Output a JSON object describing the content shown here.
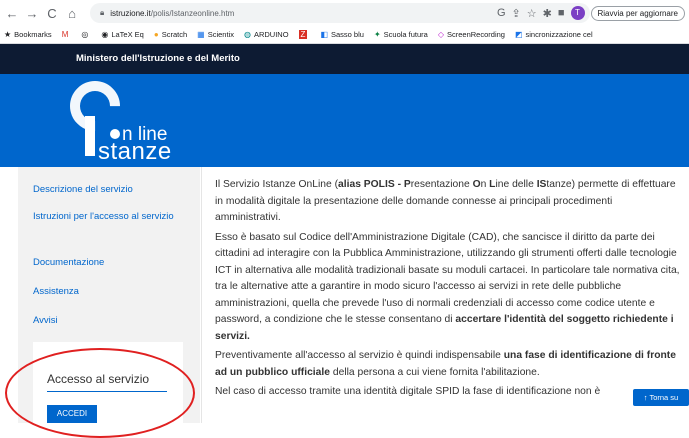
{
  "browser": {
    "back": "←",
    "forward": "→",
    "reload": "C",
    "home": "⌂",
    "url_domain": "istruzione.it",
    "url_path": "/polis/Istanzeonline.htm",
    "reload_pill": "Riavvia per aggiornare"
  },
  "bookmarks": [
    {
      "icon": "★",
      "label": "Bookmarks"
    },
    {
      "icon": "M",
      "label": ""
    },
    {
      "icon": "◎",
      "label": ""
    },
    {
      "icon": "◉",
      "label": "LaTeX Eq"
    },
    {
      "icon": "●",
      "label": "Scratch"
    },
    {
      "icon": "▦",
      "label": "Scientix"
    },
    {
      "icon": "◍",
      "label": "ARDUINO"
    },
    {
      "icon": "Z",
      "label": ""
    },
    {
      "icon": "◧",
      "label": "Sasso blu"
    },
    {
      "icon": "✦",
      "label": "Scuola futura"
    },
    {
      "icon": "◇",
      "label": "ScreenRecording"
    },
    {
      "icon": "◩",
      "label": "sincronizzazione cel"
    }
  ],
  "header": {
    "ministry": "Ministero dell'Istruzione e del Merito",
    "logo_online": "n line",
    "logo_istanze": "stanze"
  },
  "sidebar": {
    "items": [
      "Descrizione del servizio",
      "Istruzioni per l'accesso al servizio",
      "Documentazione",
      "Assistenza",
      "Avvisi"
    ],
    "access_title": "Accesso al servizio",
    "access_button": "ACCEDI"
  },
  "content": {
    "p1_a": "Il Servizio Istanze OnLine (",
    "p1_b": "alias POLIS - P",
    "p1_c": "resentazione ",
    "p1_d": "O",
    "p1_e": "n ",
    "p1_f": "L",
    "p1_g": "ine delle ",
    "p1_h": "IS",
    "p1_i": "tanze) permette di effettuare in modalità digitale la presentazione delle domande connesse ai principali procedimenti amministrativi.",
    "p2_a": "Esso è basato sul Codice dell'Amministrazione Digitale (CAD), che sancisce il diritto da parte dei cittadini ad interagire con la Pubblica Amministrazione, utilizzando gli strumenti offerti dalle tecnologie ICT in alternativa alle modalità tradizionali basate su moduli cartacei. In particolare tale normativa cita, tra le alternative atte a garantire in modo sicuro l'accesso ai servizi in rete delle pubbliche amministrazioni, quella che prevede l'uso di normali credenziali di accesso come codice utente e password, a condizione che le stesse consentano di ",
    "p2_b": "accertare l'identità del soggetto richiedente i servizi.",
    "p3_a": "Preventivamente all'accesso al servizio è quindi indispensabile ",
    "p3_b": "una fase di identificazione di fronte ad un pubblico ufficiale",
    "p3_c": " della persona a cui viene fornita l'abilitazione.",
    "p4": "Nel caso di accesso tramite una identità digitale SPID la fase di identificazione non è"
  },
  "torna_su": "Torna su",
  "colors": {
    "brand_blue": "#0066cc",
    "ministry_bar": "#0d1b33",
    "annotation_red": "#e02020"
  }
}
